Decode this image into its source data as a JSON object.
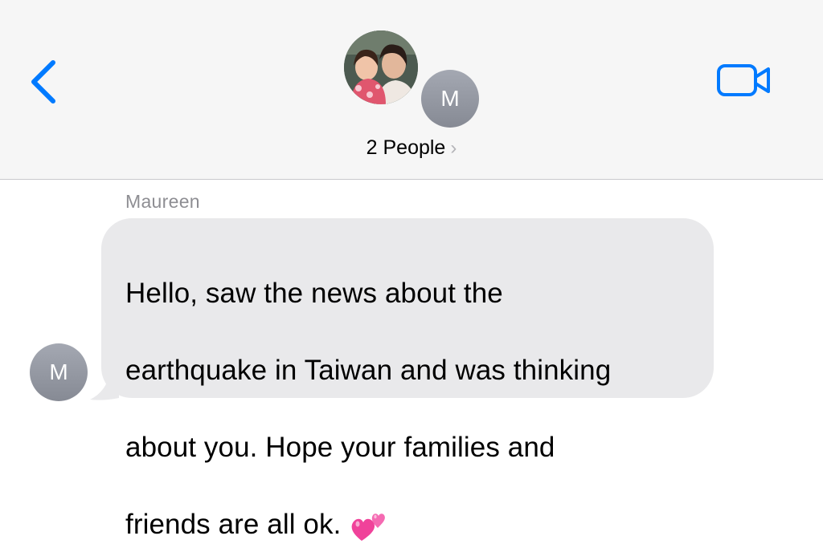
{
  "header": {
    "back_icon": "chevron-left-icon",
    "video_icon": "video-camera-icon",
    "accent_color": "#007aff",
    "participant_initial": "M",
    "title": "2 People",
    "title_chevron": "›"
  },
  "conversation": {
    "messages": [
      {
        "sender": "Maureen",
        "avatar_initial": "M",
        "text_lines": [
          "Hello, saw the news about the",
          "earthquake in Taiwan and was thinking",
          "about you. Hope your families and",
          "friends are all ok."
        ],
        "emoji": "two-hearts-icon",
        "bubble_color": "#e9e9eb"
      }
    ]
  }
}
